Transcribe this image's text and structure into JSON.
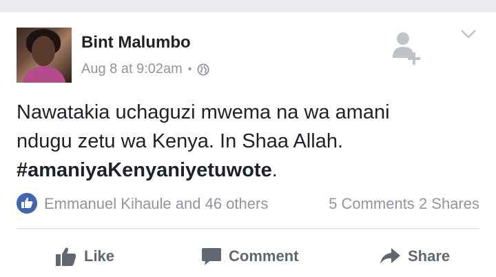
{
  "post": {
    "author": "Bint Malumbo",
    "timestamp": "Aug 8 at 9:02am",
    "separator": "•",
    "privacy_icon": "globe-icon",
    "text_line1": "Nawatakia uchaguzi mwema na wa amani",
    "text_line2": "ndugu zetu wa Kenya. In Shaa Allah.",
    "hashtag": "#amaniyaKenyaniyetuwote",
    "hashtag_suffix": "."
  },
  "reactions": {
    "likers": "Emmanuel Kihaule and 46 others",
    "comments": "5 Comments",
    "shares": "2 Shares"
  },
  "actions": {
    "like_label": "Like",
    "comment_label": "Comment",
    "share_label": "Share"
  },
  "colors": {
    "text": "#1d2129",
    "muted": "#90949c",
    "action": "#606770",
    "accent": "#4267b2",
    "divider": "#dddfe2"
  }
}
